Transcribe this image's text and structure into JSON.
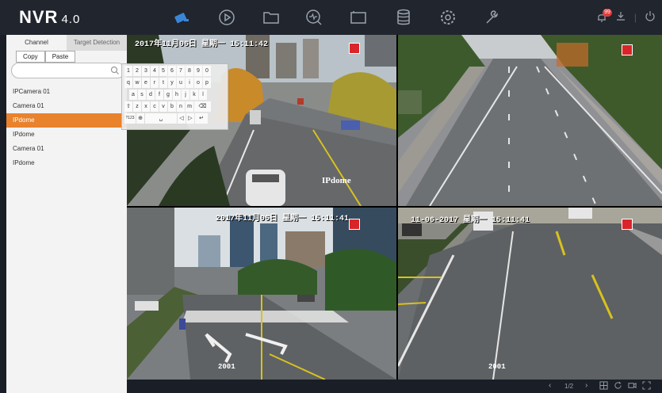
{
  "app": {
    "title": "NVR",
    "version": "4.0"
  },
  "nav_icons": [
    "live-view-icon",
    "playback-icon",
    "file-icon",
    "smart-analysis-icon",
    "monitor-icon",
    "storage-icon",
    "settings-icon",
    "maintenance-icon"
  ],
  "alerts": {
    "count": "99"
  },
  "left_panel": {
    "tabs": [
      "Channel",
      "Target Detection"
    ],
    "copy_label": "Copy",
    "paste_label": "Paste",
    "search_value": "",
    "channels": [
      "IPCamera 01",
      "Camera 01",
      "IPdome",
      "IPdome",
      "Camera 01",
      "IPdome"
    ],
    "selected_index": 2
  },
  "keyboard": {
    "rows": [
      [
        "1",
        "2",
        "3",
        "4",
        "5",
        "6",
        "7",
        "8",
        "9",
        "0"
      ],
      [
        "q",
        "w",
        "e",
        "r",
        "t",
        "y",
        "u",
        "i",
        "o",
        "p"
      ],
      [
        "a",
        "s",
        "d",
        "f",
        "g",
        "h",
        "j",
        "k",
        "l"
      ],
      [
        "⇧",
        "z",
        "x",
        "c",
        "v",
        "b",
        "n",
        "m",
        "⌫"
      ],
      [
        "?123",
        "⊕",
        "␣",
        "◁",
        "▷",
        "↵"
      ]
    ]
  },
  "cameras": [
    {
      "timestamp": "2017年11月06日 星期一 15:11:42",
      "name": "IPdome",
      "number": ""
    },
    {
      "timestamp": "",
      "name": "",
      "number": ""
    },
    {
      "timestamp": "2017年11月06日 星期一 15:11:41",
      "name": "",
      "number": "2001"
    },
    {
      "timestamp": "11-06-2017 星期一 15:11:41",
      "name": "",
      "number": "2001"
    }
  ],
  "bottom": {
    "page": "1/2"
  },
  "colors": {
    "accent": "#e8822d",
    "record": "#d9252a",
    "nav_active": "#3a86d6"
  }
}
